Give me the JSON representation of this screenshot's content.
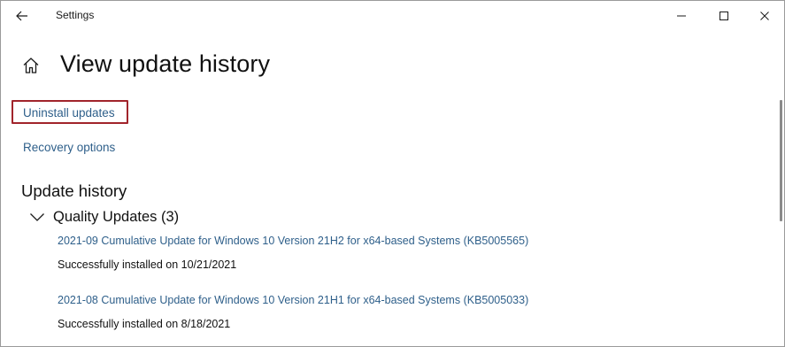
{
  "window": {
    "title": "Settings"
  },
  "header": {
    "title": "View update history"
  },
  "links": {
    "uninstall": "Uninstall updates",
    "recovery": "Recovery options"
  },
  "history": {
    "section_title": "Update history",
    "group_title": "Quality Updates (3)",
    "items": [
      {
        "title": "2021-09 Cumulative Update for Windows 10 Version 21H2 for x64-based Systems (KB5005565)",
        "status": "Successfully installed on 10/21/2021"
      },
      {
        "title": "2021-08 Cumulative Update for Windows 10 Version 21H1 for x64-based Systems (KB5005033)",
        "status": "Successfully installed on 8/18/2021"
      }
    ]
  },
  "icons": {
    "back": "back-arrow-icon",
    "minimize": "minimize-icon",
    "maximize": "maximize-icon",
    "close": "close-icon",
    "home": "home-icon",
    "chevron": "chevron-down-icon"
  },
  "colors": {
    "link": "#2e5f8a",
    "highlight": "#a1242b",
    "text": "#111111"
  }
}
